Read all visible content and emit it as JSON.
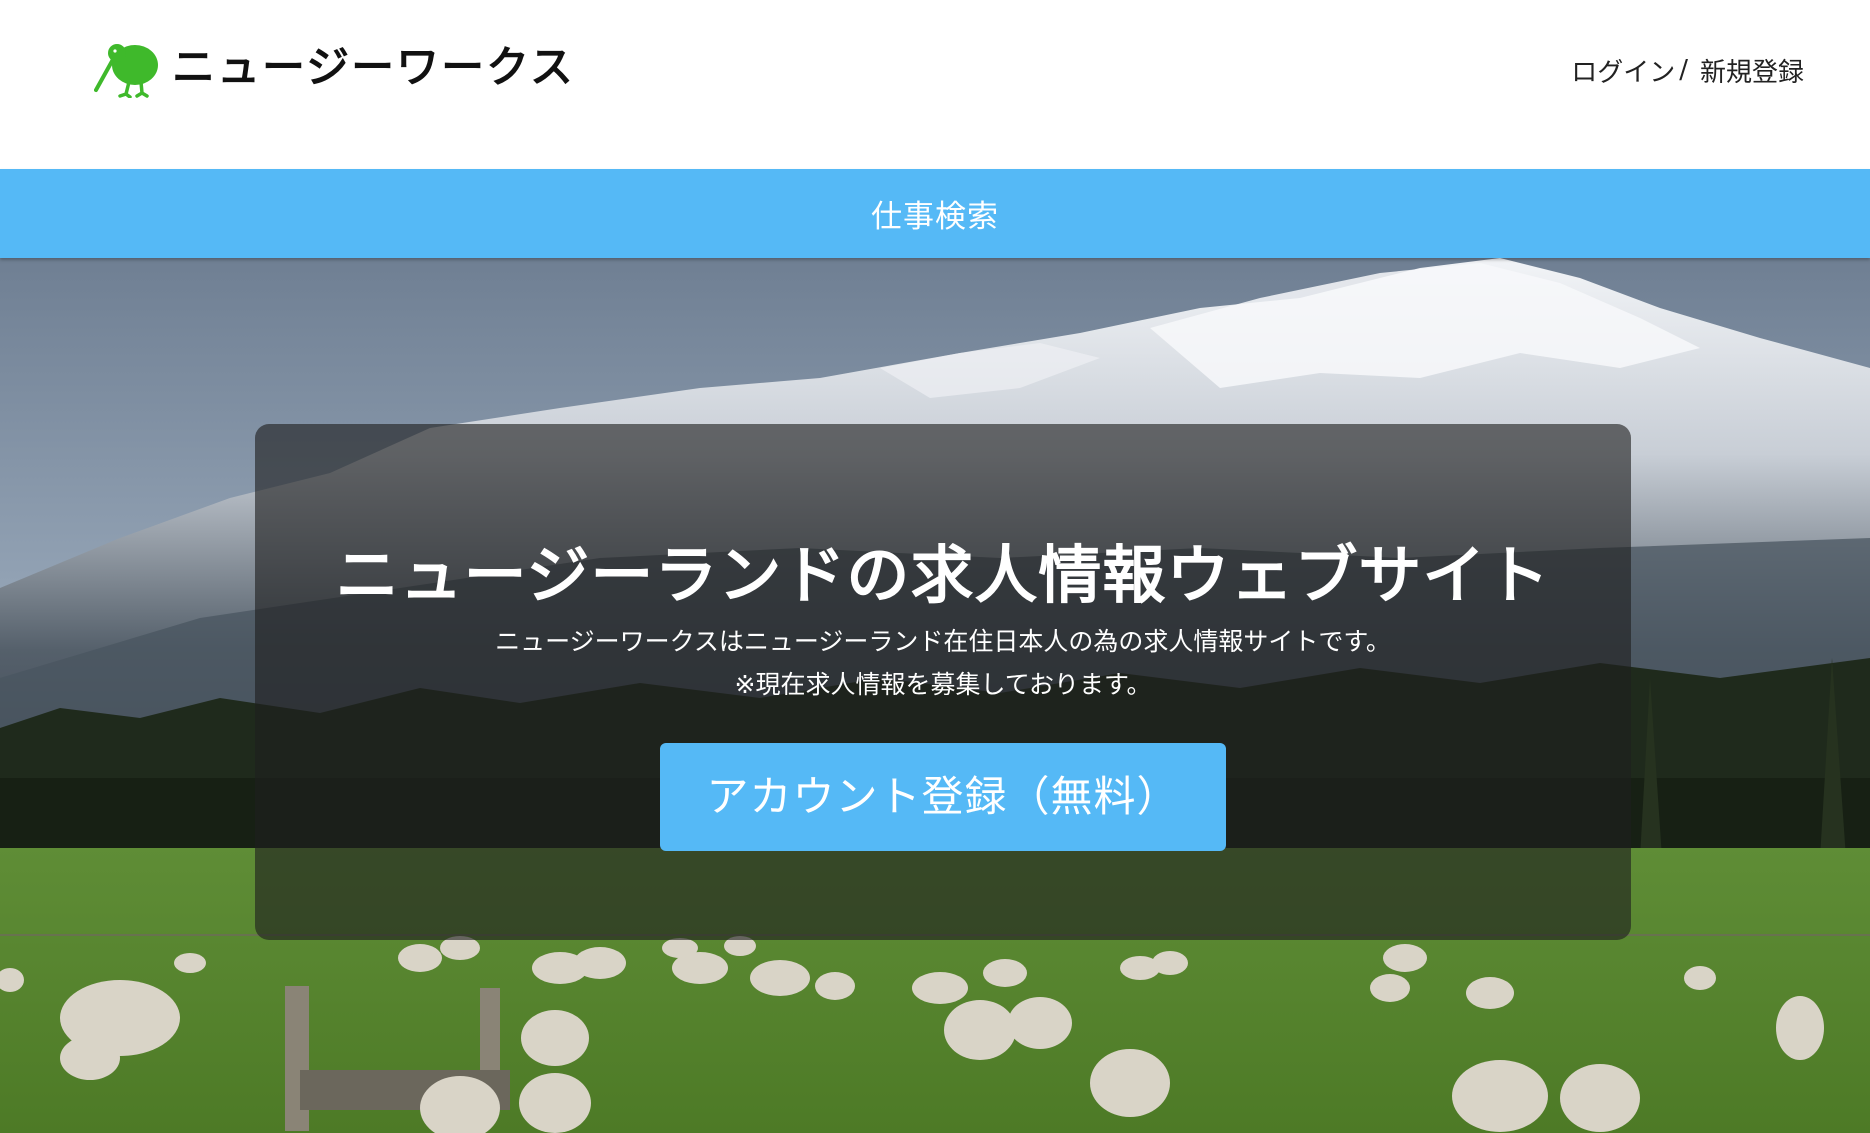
{
  "header": {
    "logo_text": "ニュージーワークス",
    "login_label": "ログイン",
    "separator": "/",
    "register_label": "新規登録"
  },
  "nav": {
    "job_search_label": "仕事検索"
  },
  "hero": {
    "title": "ニュージーランドの求人情報ウェブサイト",
    "description_line1": "ニュージーワークスはニュージーランド在住日本人の為の求人情報サイトです。",
    "description_line2": "※現在求人情報を募集しております。",
    "cta_label": "アカウント登録（無料）"
  },
  "colors": {
    "accent": "#55b9f6",
    "logo_green": "#3fb92b",
    "panel_overlay": "rgba(30,30,30,0.62)"
  },
  "icons": {
    "logo": "kiwi-bird-icon"
  }
}
